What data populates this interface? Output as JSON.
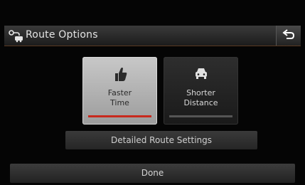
{
  "header": {
    "title": "Route Options",
    "icon": "route-options-icon",
    "back_icon": "back-arrow-icon"
  },
  "options": [
    {
      "label_line1": "Faster",
      "label_line2": "Time",
      "icon": "thumbs-up-icon",
      "selected": true
    },
    {
      "label_line1": "Shorter",
      "label_line2": "Distance",
      "icon": "car-icon",
      "selected": false
    }
  ],
  "buttons": {
    "detailed": "Detailed Route Settings",
    "done": "Done"
  },
  "colors": {
    "selected_indicator": "#c8291d",
    "header_border": "#5a3a22"
  }
}
